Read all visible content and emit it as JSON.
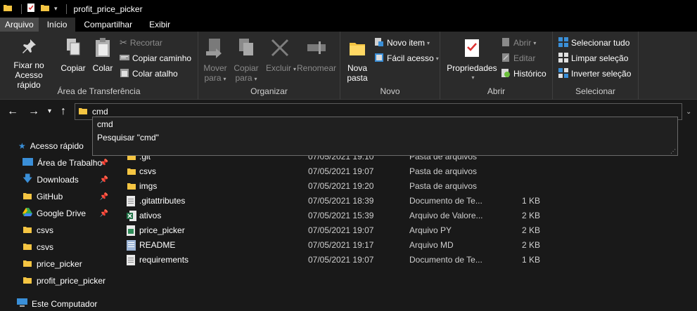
{
  "titlebar": {
    "title": "profit_price_picker"
  },
  "tabs": [
    {
      "label": "Arquivo"
    },
    {
      "label": "Início"
    },
    {
      "label": "Compartilhar"
    },
    {
      "label": "Exibir"
    }
  ],
  "ribbon": {
    "clipboard": {
      "pin_label_1": "Fixar no",
      "pin_label_2": "Acesso rápido",
      "copy": "Copiar",
      "paste": "Colar",
      "cut": "Recortar",
      "copy_path": "Copiar caminho",
      "paste_shortcut": "Colar atalho",
      "group": "Área de Transferência"
    },
    "organize": {
      "move_1": "Mover",
      "move_2": "para",
      "copy_1": "Copiar",
      "copy_2": "para",
      "delete": "Excluir",
      "rename": "Renomear",
      "group": "Organizar"
    },
    "new": {
      "new_folder_1": "Nova",
      "new_folder_2": "pasta",
      "new_item": "Novo item",
      "easy_access": "Fácil acesso",
      "group": "Novo"
    },
    "open": {
      "properties": "Propriedades",
      "open": "Abrir",
      "edit": "Editar",
      "history": "Histórico",
      "group": "Abrir"
    },
    "select": {
      "select_all": "Selecionar tudo",
      "select_none": "Limpar seleção",
      "invert": "Inverter seleção",
      "group": "Selecionar"
    }
  },
  "address": {
    "value": "cmd"
  },
  "suggestions": [
    {
      "label": "cmd"
    },
    {
      "label": "Pesquisar \"cmd\""
    }
  ],
  "nav": [
    {
      "label": "Acesso rápido"
    },
    {
      "label": "Área de Trabalho"
    },
    {
      "label": "Downloads"
    },
    {
      "label": "GitHub"
    },
    {
      "label": "Google Drive"
    },
    {
      "label": "csvs"
    },
    {
      "label": "csvs"
    },
    {
      "label": "price_picker"
    },
    {
      "label": "profit_price_picker"
    },
    {
      "label": "Este Computador"
    }
  ],
  "files": [
    {
      "name": ".git",
      "date": "07/05/2021 19:10",
      "type": "Pasta de arquivos",
      "size": ""
    },
    {
      "name": "csvs",
      "date": "07/05/2021 19:07",
      "type": "Pasta de arquivos",
      "size": ""
    },
    {
      "name": "imgs",
      "date": "07/05/2021 19:20",
      "type": "Pasta de arquivos",
      "size": ""
    },
    {
      "name": ".gitattributes",
      "date": "07/05/2021 18:39",
      "type": "Documento de Te...",
      "size": "1 KB"
    },
    {
      "name": "ativos",
      "date": "07/05/2021 15:39",
      "type": "Arquivo de Valore...",
      "size": "2 KB"
    },
    {
      "name": "price_picker",
      "date": "07/05/2021 19:07",
      "type": "Arquivo PY",
      "size": "2 KB"
    },
    {
      "name": "README",
      "date": "07/05/2021 19:17",
      "type": "Arquivo MD",
      "size": "2 KB"
    },
    {
      "name": "requirements",
      "date": "07/05/2021 19:07",
      "type": "Documento de Te...",
      "size": "1 KB"
    }
  ]
}
